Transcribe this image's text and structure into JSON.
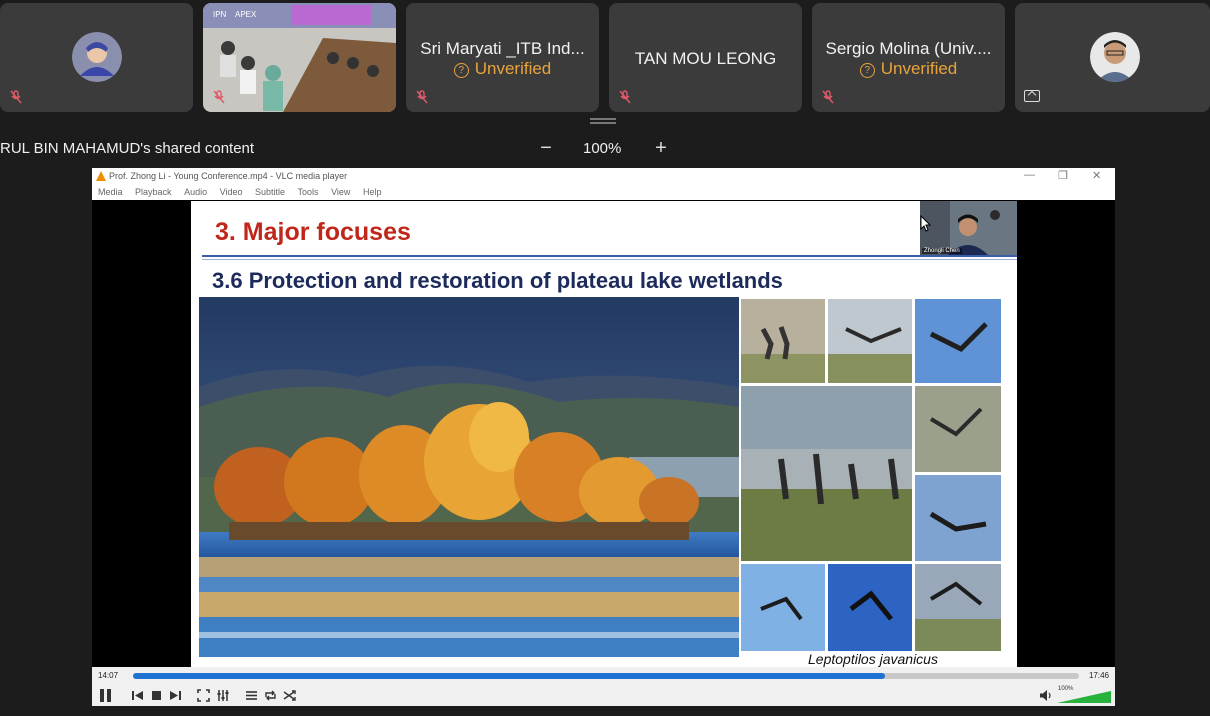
{
  "participants": [
    {
      "type": "avatar",
      "muted": true
    },
    {
      "type": "video",
      "muted": true
    },
    {
      "type": "name",
      "name": "Sri Maryati _ITB Ind...",
      "status": "Unverified",
      "muted": true
    },
    {
      "type": "name",
      "name": "TAN MOU LEONG",
      "muted": true
    },
    {
      "type": "name",
      "name": "Sergio Molina (Univ....",
      "status": "Unverified",
      "muted": true
    },
    {
      "type": "avatar",
      "muted": false
    }
  ],
  "share": {
    "label": "RUL BIN MAHAMUD's shared content",
    "zoom": "100%",
    "zoom_minus": "−",
    "zoom_plus": "+"
  },
  "vlc": {
    "title": "Prof. Zhong Li - Young Conference.mp4 - VLC media player",
    "menu": [
      "Media",
      "Playback",
      "Audio",
      "Video",
      "Subtitle",
      "Tools",
      "View",
      "Help"
    ],
    "current_time": "14:07",
    "total_time": "17:46",
    "progress": 0.795,
    "volume_label": "100%",
    "volume_level": 1.0
  },
  "slide": {
    "heading": "3. Major focuses",
    "subheading": "3.6 Protection and restoration of plateau lake wetlands",
    "caption": "Leptoptilos javanicus",
    "webcam_label": "Zhongli Chen"
  },
  "colors": {
    "unverified": "#e8a33d",
    "heading_red": "#c0271a",
    "subheading_navy": "#1d2b5c",
    "progress_blue": "#1f72d1"
  }
}
